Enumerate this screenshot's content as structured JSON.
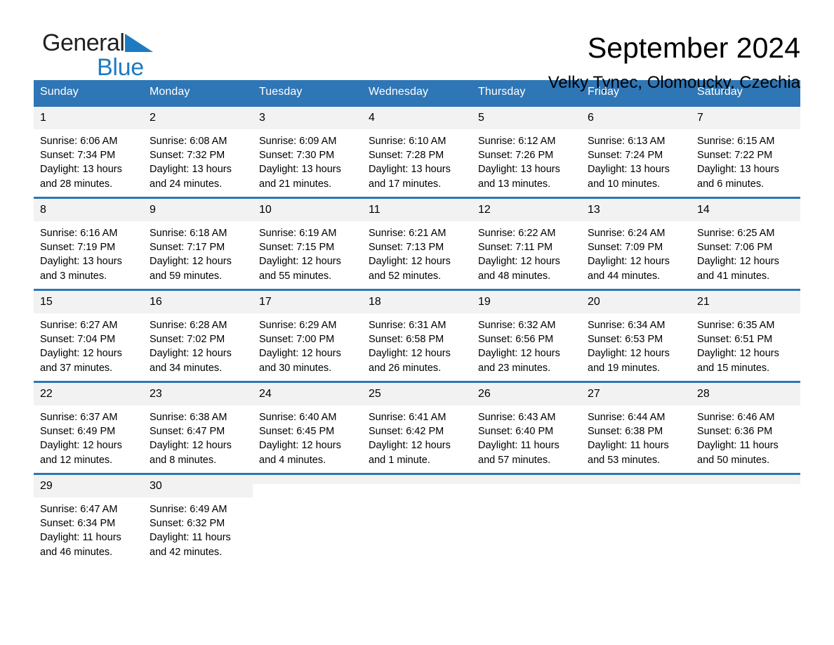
{
  "brand": {
    "name_part1": "General",
    "name_part2": "Blue",
    "triangle_color": "#1f7bc1"
  },
  "header": {
    "title": "September 2024",
    "subtitle": "Velky Tynec, Olomoucky, Czechia"
  },
  "colors": {
    "header_blue": "#2e76b6",
    "daynum_gray": "#f2f2f2",
    "text": "#000000",
    "header_text": "#ffffff"
  },
  "weekday_headers": [
    "Sunday",
    "Monday",
    "Tuesday",
    "Wednesday",
    "Thursday",
    "Friday",
    "Saturday"
  ],
  "weeks": [
    [
      {
        "day": "1",
        "sunrise": "Sunrise: 6:06 AM",
        "sunset": "Sunset: 7:34 PM",
        "daylight1": "Daylight: 13 hours",
        "daylight2": "and 28 minutes."
      },
      {
        "day": "2",
        "sunrise": "Sunrise: 6:08 AM",
        "sunset": "Sunset: 7:32 PM",
        "daylight1": "Daylight: 13 hours",
        "daylight2": "and 24 minutes."
      },
      {
        "day": "3",
        "sunrise": "Sunrise: 6:09 AM",
        "sunset": "Sunset: 7:30 PM",
        "daylight1": "Daylight: 13 hours",
        "daylight2": "and 21 minutes."
      },
      {
        "day": "4",
        "sunrise": "Sunrise: 6:10 AM",
        "sunset": "Sunset: 7:28 PM",
        "daylight1": "Daylight: 13 hours",
        "daylight2": "and 17 minutes."
      },
      {
        "day": "5",
        "sunrise": "Sunrise: 6:12 AM",
        "sunset": "Sunset: 7:26 PM",
        "daylight1": "Daylight: 13 hours",
        "daylight2": "and 13 minutes."
      },
      {
        "day": "6",
        "sunrise": "Sunrise: 6:13 AM",
        "sunset": "Sunset: 7:24 PM",
        "daylight1": "Daylight: 13 hours",
        "daylight2": "and 10 minutes."
      },
      {
        "day": "7",
        "sunrise": "Sunrise: 6:15 AM",
        "sunset": "Sunset: 7:22 PM",
        "daylight1": "Daylight: 13 hours",
        "daylight2": "and 6 minutes."
      }
    ],
    [
      {
        "day": "8",
        "sunrise": "Sunrise: 6:16 AM",
        "sunset": "Sunset: 7:19 PM",
        "daylight1": "Daylight: 13 hours",
        "daylight2": "and 3 minutes."
      },
      {
        "day": "9",
        "sunrise": "Sunrise: 6:18 AM",
        "sunset": "Sunset: 7:17 PM",
        "daylight1": "Daylight: 12 hours",
        "daylight2": "and 59 minutes."
      },
      {
        "day": "10",
        "sunrise": "Sunrise: 6:19 AM",
        "sunset": "Sunset: 7:15 PM",
        "daylight1": "Daylight: 12 hours",
        "daylight2": "and 55 minutes."
      },
      {
        "day": "11",
        "sunrise": "Sunrise: 6:21 AM",
        "sunset": "Sunset: 7:13 PM",
        "daylight1": "Daylight: 12 hours",
        "daylight2": "and 52 minutes."
      },
      {
        "day": "12",
        "sunrise": "Sunrise: 6:22 AM",
        "sunset": "Sunset: 7:11 PM",
        "daylight1": "Daylight: 12 hours",
        "daylight2": "and 48 minutes."
      },
      {
        "day": "13",
        "sunrise": "Sunrise: 6:24 AM",
        "sunset": "Sunset: 7:09 PM",
        "daylight1": "Daylight: 12 hours",
        "daylight2": "and 44 minutes."
      },
      {
        "day": "14",
        "sunrise": "Sunrise: 6:25 AM",
        "sunset": "Sunset: 7:06 PM",
        "daylight1": "Daylight: 12 hours",
        "daylight2": "and 41 minutes."
      }
    ],
    [
      {
        "day": "15",
        "sunrise": "Sunrise: 6:27 AM",
        "sunset": "Sunset: 7:04 PM",
        "daylight1": "Daylight: 12 hours",
        "daylight2": "and 37 minutes."
      },
      {
        "day": "16",
        "sunrise": "Sunrise: 6:28 AM",
        "sunset": "Sunset: 7:02 PM",
        "daylight1": "Daylight: 12 hours",
        "daylight2": "and 34 minutes."
      },
      {
        "day": "17",
        "sunrise": "Sunrise: 6:29 AM",
        "sunset": "Sunset: 7:00 PM",
        "daylight1": "Daylight: 12 hours",
        "daylight2": "and 30 minutes."
      },
      {
        "day": "18",
        "sunrise": "Sunrise: 6:31 AM",
        "sunset": "Sunset: 6:58 PM",
        "daylight1": "Daylight: 12 hours",
        "daylight2": "and 26 minutes."
      },
      {
        "day": "19",
        "sunrise": "Sunrise: 6:32 AM",
        "sunset": "Sunset: 6:56 PM",
        "daylight1": "Daylight: 12 hours",
        "daylight2": "and 23 minutes."
      },
      {
        "day": "20",
        "sunrise": "Sunrise: 6:34 AM",
        "sunset": "Sunset: 6:53 PM",
        "daylight1": "Daylight: 12 hours",
        "daylight2": "and 19 minutes."
      },
      {
        "day": "21",
        "sunrise": "Sunrise: 6:35 AM",
        "sunset": "Sunset: 6:51 PM",
        "daylight1": "Daylight: 12 hours",
        "daylight2": "and 15 minutes."
      }
    ],
    [
      {
        "day": "22",
        "sunrise": "Sunrise: 6:37 AM",
        "sunset": "Sunset: 6:49 PM",
        "daylight1": "Daylight: 12 hours",
        "daylight2": "and 12 minutes."
      },
      {
        "day": "23",
        "sunrise": "Sunrise: 6:38 AM",
        "sunset": "Sunset: 6:47 PM",
        "daylight1": "Daylight: 12 hours",
        "daylight2": "and 8 minutes."
      },
      {
        "day": "24",
        "sunrise": "Sunrise: 6:40 AM",
        "sunset": "Sunset: 6:45 PM",
        "daylight1": "Daylight: 12 hours",
        "daylight2": "and 4 minutes."
      },
      {
        "day": "25",
        "sunrise": "Sunrise: 6:41 AM",
        "sunset": "Sunset: 6:42 PM",
        "daylight1": "Daylight: 12 hours",
        "daylight2": "and 1 minute."
      },
      {
        "day": "26",
        "sunrise": "Sunrise: 6:43 AM",
        "sunset": "Sunset: 6:40 PM",
        "daylight1": "Daylight: 11 hours",
        "daylight2": "and 57 minutes."
      },
      {
        "day": "27",
        "sunrise": "Sunrise: 6:44 AM",
        "sunset": "Sunset: 6:38 PM",
        "daylight1": "Daylight: 11 hours",
        "daylight2": "and 53 minutes."
      },
      {
        "day": "28",
        "sunrise": "Sunrise: 6:46 AM",
        "sunset": "Sunset: 6:36 PM",
        "daylight1": "Daylight: 11 hours",
        "daylight2": "and 50 minutes."
      }
    ],
    [
      {
        "day": "29",
        "sunrise": "Sunrise: 6:47 AM",
        "sunset": "Sunset: 6:34 PM",
        "daylight1": "Daylight: 11 hours",
        "daylight2": "and 46 minutes."
      },
      {
        "day": "30",
        "sunrise": "Sunrise: 6:49 AM",
        "sunset": "Sunset: 6:32 PM",
        "daylight1": "Daylight: 11 hours",
        "daylight2": "and 42 minutes."
      },
      {
        "day": "",
        "sunrise": "",
        "sunset": "",
        "daylight1": "",
        "daylight2": "",
        "blank": true
      },
      {
        "day": "",
        "sunrise": "",
        "sunset": "",
        "daylight1": "",
        "daylight2": "",
        "blank": true
      },
      {
        "day": "",
        "sunrise": "",
        "sunset": "",
        "daylight1": "",
        "daylight2": "",
        "blank": true
      },
      {
        "day": "",
        "sunrise": "",
        "sunset": "",
        "daylight1": "",
        "daylight2": "",
        "blank": true
      },
      {
        "day": "",
        "sunrise": "",
        "sunset": "",
        "daylight1": "",
        "daylight2": "",
        "blank": true
      }
    ]
  ]
}
